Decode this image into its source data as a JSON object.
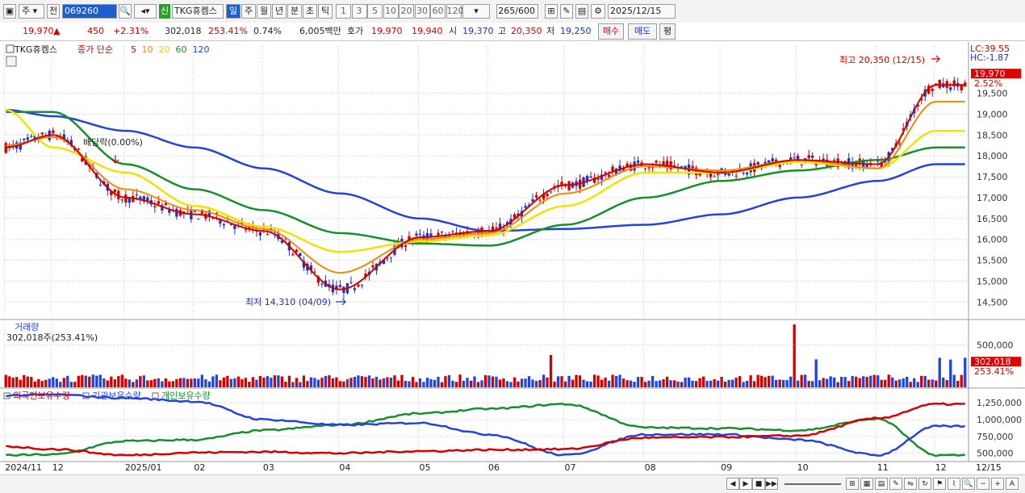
{
  "toolbar": {
    "market": "주",
    "prev_label": "전",
    "code": "069260",
    "credit_badge": "신",
    "name": "TKG휴켐스",
    "periods": [
      "일",
      "주",
      "월",
      "년",
      "분",
      "초",
      "틱"
    ],
    "active_period": "일",
    "intervals": [
      "1",
      "3",
      "5",
      "10",
      "20",
      "30",
      "60",
      "120"
    ],
    "count": "265",
    "count_max": "/600",
    "date": "2025/12/15"
  },
  "quote": {
    "price": "19,970",
    "change_arrow": "▲",
    "change": "450",
    "change_pct": "+2.31%",
    "volume": "302,018",
    "volume_ratio": "253.41%",
    "turnover": "0.74%",
    "amount": "6,005백만",
    "ask_label": "호가",
    "ask": "19,970",
    "bid": "19,940",
    "open_label": "시",
    "open": "19,370",
    "high_label": "고",
    "high": "20,350",
    "low_label": "저",
    "low": "19,250",
    "buy_label": "매수",
    "sell_label": "매도",
    "flat_label": "평"
  },
  "chart_data": {
    "type": "candlestick",
    "price_panel": {
      "legend": [
        {
          "label": "TKG휴켐스",
          "color": "#222222"
        },
        {
          "label": "종가 단순",
          "color": "#d40000"
        },
        {
          "label": "5",
          "color": "#d40000"
        },
        {
          "label": "10",
          "color": "#f08c00"
        },
        {
          "label": "20",
          "color": "#e6d200"
        },
        {
          "label": "60",
          "color": "#16902a"
        },
        {
          "label": "120",
          "color": "#2244dd"
        }
      ],
      "lc_label": "LC:39.55",
      "hc_label": "HC:-1.87",
      "current_price": "19,970",
      "current_pct": "2.52%",
      "high_annotation": "최고 20,350 (12/15)",
      "low_annotation": "최저 14,310 (04/09)",
      "dividend_annotation": "배당락(0.00%)",
      "y_ticks": [
        "19,500",
        "19,000",
        "18,500",
        "18,000",
        "17,500",
        "17,000",
        "16,500",
        "16,000",
        "15,500",
        "15,000",
        "14,500"
      ],
      "ylim": [
        14100,
        20650
      ],
      "ma_anchor_dates": [
        "2024/11",
        "2024/12",
        "2025/01",
        "2025/02",
        "2025/03",
        "2025/04",
        "2025/05",
        "2025/06",
        "2025/07",
        "2025/08",
        "2025/09",
        "2025/10",
        "2025/11",
        "2025/12"
      ],
      "ma5": [
        18200,
        18500,
        17000,
        16600,
        16200,
        14800,
        16050,
        16200,
        17300,
        17800,
        17600,
        17900,
        17800,
        19700
      ],
      "ma10": [
        18250,
        18450,
        17200,
        16700,
        16250,
        15200,
        16000,
        16150,
        17100,
        17750,
        17650,
        17900,
        17700,
        19300
      ],
      "ma20": [
        19100,
        18200,
        17600,
        16800,
        16300,
        15700,
        15950,
        16100,
        16800,
        17600,
        17600,
        17850,
        17700,
        18600
      ],
      "ma60": [
        19050,
        19050,
        17800,
        17200,
        16700,
        16150,
        15900,
        15850,
        16350,
        17000,
        17400,
        17650,
        17900,
        18200
      ],
      "ma120": [
        19100,
        18950,
        18600,
        18200,
        17700,
        17100,
        16500,
        16200,
        16250,
        16350,
        16600,
        17000,
        17400,
        17800
      ]
    },
    "volume_panel": {
      "title": "거래량",
      "info": "302,018주(253.41%)",
      "y_ticks": [
        "500,000"
      ],
      "ylim": [
        0,
        760000
      ],
      "current": "302,018",
      "current_pct": "253.41%"
    },
    "holdings_panel": {
      "legend": [
        {
          "label": "외국인보유수량",
          "color": "#d40000"
        },
        {
          "label": "기관보유수량",
          "color": "#2244dd"
        },
        {
          "label": "개인보유수량",
          "color": "#16902a"
        }
      ],
      "y_ticks": [
        "1,250,000",
        "1,000,000",
        "750,000",
        "500,000"
      ],
      "ylim": [
        400000,
        1420000
      ],
      "anchor_dates": [
        "2024/11",
        "2024/12",
        "2025/01",
        "2025/02",
        "2025/03",
        "2025/04",
        "2025/05",
        "2025/06",
        "2025/07",
        "2025/08",
        "2025/09",
        "2025/10",
        "2025/11",
        "2025/12"
      ],
      "foreign": [
        600000,
        560000,
        470000,
        510000,
        520000,
        500000,
        530000,
        550000,
        560000,
        730000,
        740000,
        760000,
        1020000,
        1230000
      ],
      "institution": [
        1360000,
        1370000,
        1320000,
        1270000,
        1000000,
        920000,
        950000,
        780000,
        470000,
        780000,
        780000,
        700000,
        470000,
        900000
      ],
      "individual": [
        470000,
        480000,
        680000,
        700000,
        840000,
        920000,
        1090000,
        1160000,
        1230000,
        880000,
        870000,
        840000,
        1010000,
        470000
      ]
    },
    "x_ticks": [
      "2024/11",
      "12",
      "2025/01",
      "02",
      "03",
      "04",
      "05",
      "06",
      "07",
      "08",
      "09",
      "10",
      "11",
      "12",
      "12/15"
    ]
  }
}
